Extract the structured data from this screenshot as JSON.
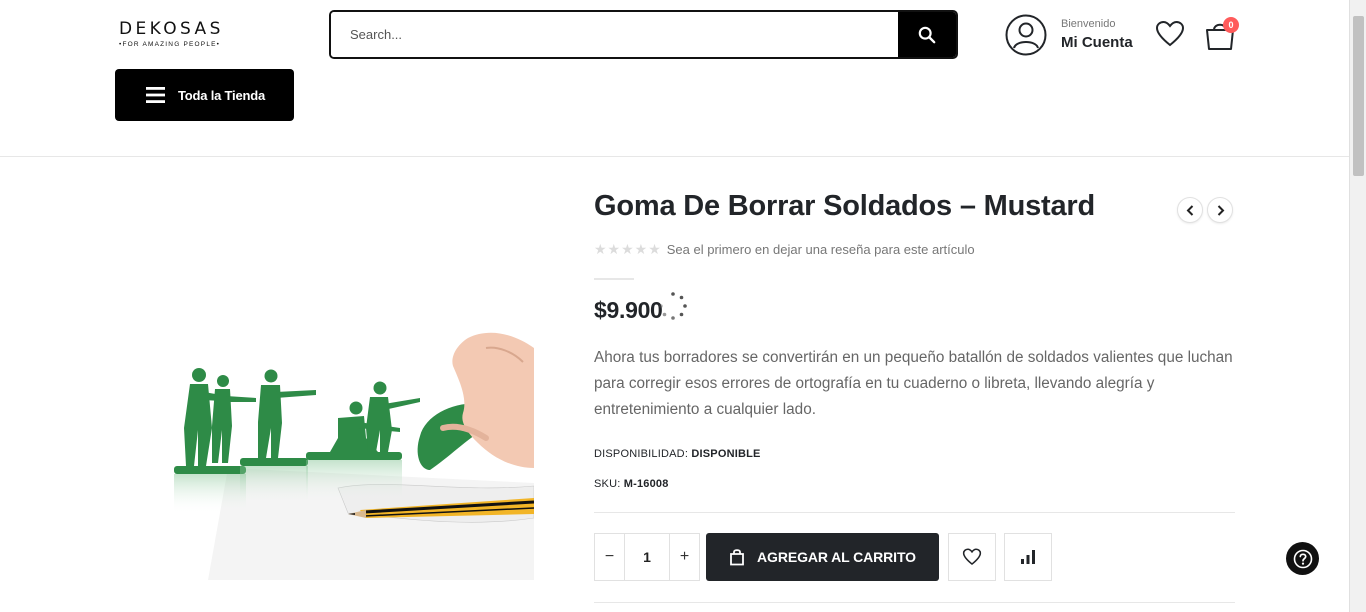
{
  "header": {
    "logo_main": "DEKOSAS",
    "logo_tag": "•FOR AMAZING PEOPLE•",
    "search_placeholder": "Search...",
    "account_greeting": "Bienvenido",
    "account_label": "Mi Cuenta",
    "cart_count": "0",
    "menu_label": "Toda la Tienda"
  },
  "product": {
    "title": "Goma De Borrar Soldados – Mustard",
    "rating_stars": "★★★★★",
    "review_prompt": "Sea el primero en dejar una reseña para este artículo",
    "price": "$9.900",
    "description": "Ahora tus borradores se convertirán en un pequeño batallón de soldados valientes que luchan para corregir esos errores de ortografía en tu cuaderno o libreta, llevando alegría y entretenimiento a cualquier lado.",
    "availability_label": "DISPONIBILIDAD:",
    "availability_value": "DISPONIBLE",
    "sku_label": "SKU:",
    "sku_value": "M-16008",
    "quantity": "1",
    "minus_label": "−",
    "plus_label": "+",
    "add_to_cart_label": "AGREGAR AL CARRITO"
  },
  "colors": {
    "primary_dark": "#222529",
    "black": "#000000",
    "badge": "#ff5b5b",
    "soldier_green": "#2e8b47"
  },
  "icons": [
    "search-icon",
    "user-icon",
    "heart-icon",
    "cart-icon",
    "menu-icon",
    "chevron-left-icon",
    "chevron-right-icon",
    "bag-icon",
    "compare-icon",
    "help-icon",
    "loading-spinner-icon"
  ]
}
